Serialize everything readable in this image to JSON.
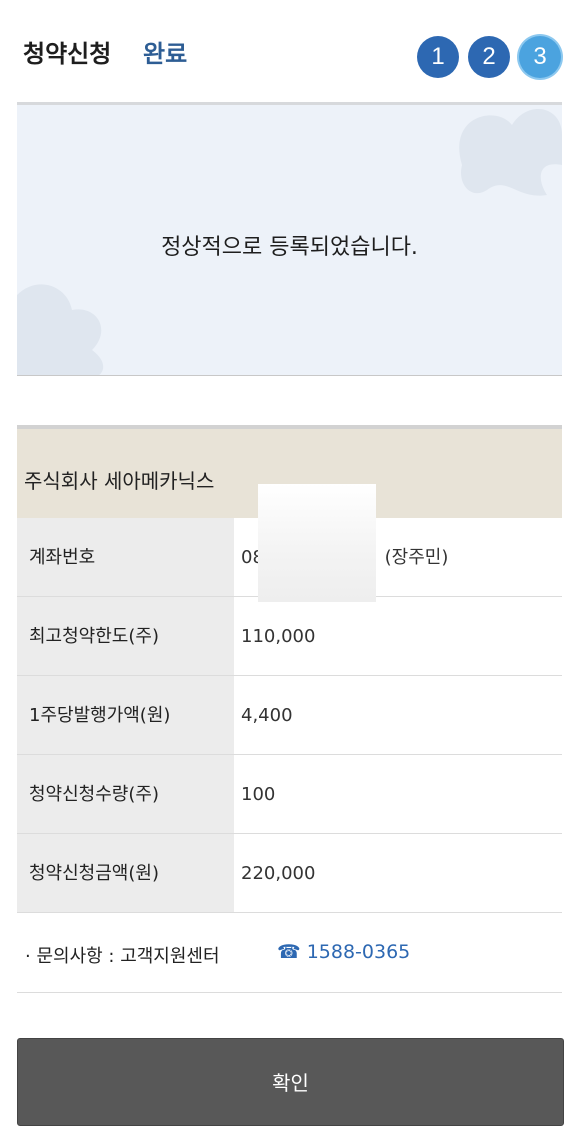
{
  "header": {
    "title": "청약신청",
    "subtitle": "완료",
    "steps": [
      "1",
      "2",
      "3"
    ]
  },
  "banner": {
    "message": "정상적으로 등록되었습니다."
  },
  "company": {
    "name": "주식회사 세아메카닉스"
  },
  "details": {
    "account": {
      "label": "계좌번호",
      "value_prefix": "08",
      "value_mid": "l",
      "holder": "(장주민)"
    },
    "max_limit": {
      "label": "최고청약한도(주)",
      "value": "110,000"
    },
    "issue_price": {
      "label": "1주당발행가액(원)",
      "value": "4,400"
    },
    "quantity": {
      "label": "청약신청수량(주)",
      "value": "100"
    },
    "amount": {
      "label": "청약신청금액(원)",
      "value": "220,000"
    }
  },
  "inquiry": {
    "label": "· 문의사항 : 고객지원센터",
    "phone_icon": "phone-icon",
    "phone": "☎ 1588-0365"
  },
  "confirm_label": "확인",
  "colors": {
    "brand_blue": "#2d68b2",
    "active_step": "#4ba3df",
    "banner_bg": "#edf2f9",
    "company_bg": "#e8e3d7",
    "button_bg": "#585858"
  }
}
